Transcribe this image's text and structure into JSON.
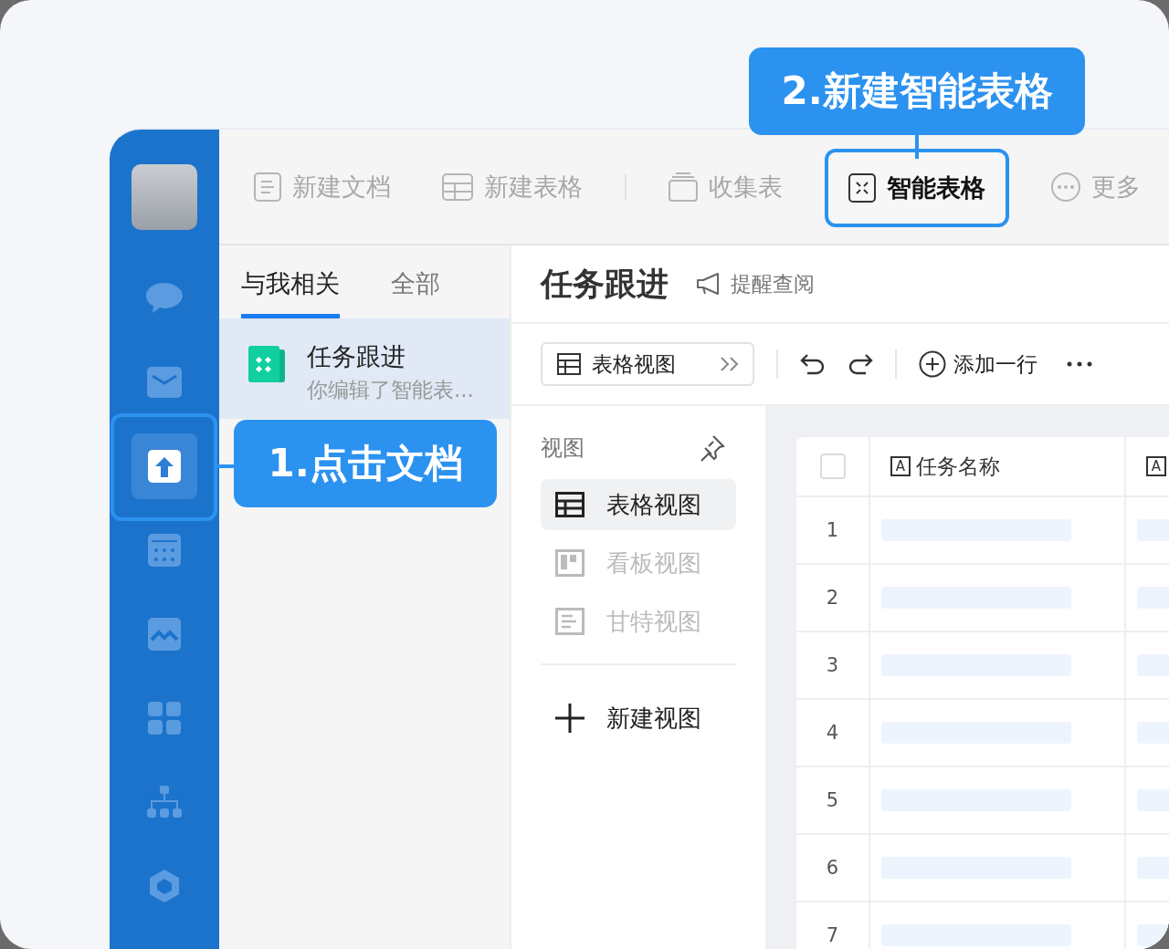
{
  "callouts": [
    {
      "text": "1.点击文档"
    },
    {
      "text": "2.新建智能表格"
    }
  ],
  "sidebar": {
    "items": [
      {
        "kind": "chat",
        "selected": false
      },
      {
        "kind": "mail",
        "selected": false
      },
      {
        "kind": "docs",
        "selected": true
      },
      {
        "kind": "calendar",
        "selected": false
      },
      {
        "kind": "gallery",
        "selected": false
      },
      {
        "kind": "apps",
        "selected": false
      },
      {
        "kind": "org",
        "selected": false
      },
      {
        "kind": "cube",
        "selected": false
      }
    ]
  },
  "toolbar": {
    "items": [
      {
        "kind": "doc",
        "label": "新建文档",
        "selected": false
      },
      {
        "kind": "sheet",
        "label": "新建表格",
        "selected": false
      },
      {
        "kind": "form",
        "label": "收集表",
        "selected": false
      },
      {
        "kind": "smart",
        "label": "智能表格",
        "selected": true
      },
      {
        "kind": "more",
        "label": "更多",
        "selected": false
      }
    ]
  },
  "file_list": {
    "tabs": [
      {
        "label": "与我相关",
        "selected": true
      },
      {
        "label": "全部",
        "selected": false
      }
    ],
    "files": [
      {
        "title": "任务跟进",
        "subtitle": "你编辑了智能表...",
        "selected": true
      }
    ]
  },
  "document": {
    "title": "任务跟进",
    "remind": "提醒查阅",
    "view_button": "表格视图",
    "add_row": "添加一行"
  },
  "views_panel": {
    "heading": "视图",
    "views": [
      {
        "kind": "grid",
        "label": "表格视图",
        "selected": true,
        "disabled": false
      },
      {
        "kind": "kanban",
        "label": "看板视图",
        "selected": false,
        "disabled": true
      },
      {
        "kind": "gantt",
        "label": "甘特视图",
        "selected": false,
        "disabled": true
      }
    ],
    "new_view": "新建视图"
  },
  "table": {
    "select_all": {
      "checked": false
    },
    "columns": [
      {
        "icon": "A",
        "label": "任务名称"
      },
      {
        "icon": "A"
      }
    ],
    "rows": [
      "1",
      "2",
      "3",
      "4",
      "5",
      "6",
      "7"
    ]
  }
}
